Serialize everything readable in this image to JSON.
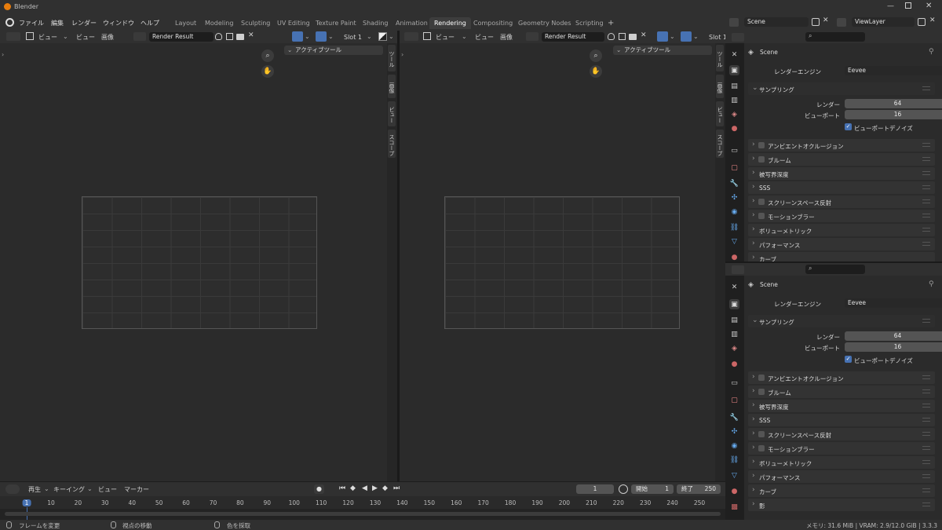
{
  "window": {
    "title": "Blender"
  },
  "menu": [
    "ファイル",
    "編集",
    "レンダー",
    "ウィンドウ",
    "ヘルプ"
  ],
  "workspaces": [
    {
      "label": "Layout",
      "active": false
    },
    {
      "label": "Modeling",
      "active": false
    },
    {
      "label": "Sculpting",
      "active": false
    },
    {
      "label": "UV Editing",
      "active": false
    },
    {
      "label": "Texture Paint",
      "active": false
    },
    {
      "label": "Shading",
      "active": false
    },
    {
      "label": "Animation",
      "active": false
    },
    {
      "label": "Rendering",
      "active": true
    },
    {
      "label": "Compositing",
      "active": false
    },
    {
      "label": "Geometry Nodes",
      "active": false
    },
    {
      "label": "Scripting",
      "active": false
    }
  ],
  "add_workspace_label": "+",
  "scene": {
    "name": "Scene",
    "view_layer": "ViewLayer"
  },
  "image_editors": [
    {
      "view_label": "ビュー",
      "image_label": "画像",
      "image_name": "Render Result",
      "slot": "Slot 1",
      "tool_panel": "アクティブツール",
      "side_tabs": [
        "ツール",
        "画像",
        "ビュー",
        "スコープ"
      ]
    },
    {
      "view_label": "ビュー",
      "image_label": "画像",
      "image_name": "Render Result",
      "slot": "Slot 1",
      "tool_panel": "アクティブツール",
      "side_tabs": [
        "ツール",
        "画像",
        "ビュー",
        "スコープ"
      ]
    }
  ],
  "properties": {
    "scene_label": "Scene",
    "render_engine_label": "レンダーエンジン",
    "render_engine": "Eevee",
    "sampling_label": "サンプリング",
    "render_label": "レンダー",
    "render_samples": "64",
    "viewport_label": "ビューポート",
    "viewport_samples": "16",
    "denoise_label": "ビューポートデノイズ",
    "sections": [
      {
        "label": "アンビエントオクルージョン",
        "checkbox": true
      },
      {
        "label": "ブルーム",
        "checkbox": true
      },
      {
        "label": "被写界深度",
        "checkbox": false
      },
      {
        "label": "SSS",
        "checkbox": false
      },
      {
        "label": "スクリーンスペース反射",
        "checkbox": true
      },
      {
        "label": "モーションブラー",
        "checkbox": true
      },
      {
        "label": "ボリューメトリック",
        "checkbox": false
      },
      {
        "label": "パフォーマンス",
        "checkbox": false
      },
      {
        "label": "カーブ",
        "checkbox": false
      },
      {
        "label": "影",
        "checkbox": false
      }
    ]
  },
  "timeline": {
    "menus": [
      "再生",
      "キーイング",
      "ビュー",
      "マーカー"
    ],
    "current_frame": "1",
    "start_label": "開始",
    "start": "1",
    "end_label": "終了",
    "end": "250",
    "ticks": [
      "1",
      "10",
      "20",
      "30",
      "40",
      "50",
      "60",
      "70",
      "80",
      "90",
      "100",
      "110",
      "120",
      "130",
      "140",
      "150",
      "160",
      "170",
      "180",
      "190",
      "200",
      "210",
      "220",
      "230",
      "240",
      "250"
    ]
  },
  "status": {
    "left": "フレームを変更",
    "middle": "視点の移動",
    "right": "色を採取",
    "info": "メモリ: 31.6 MiB | VRAM: 2.9/12.0 GiB | 3.3.3"
  },
  "colors": {
    "accent": "#4772b3",
    "bg": "#1d1d1d",
    "panel": "#303030"
  }
}
